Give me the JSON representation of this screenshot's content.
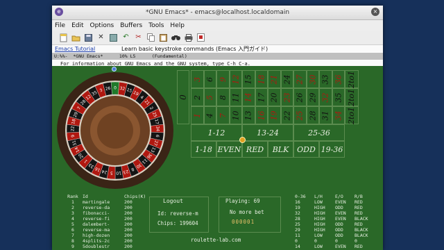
{
  "window": {
    "title": "*GNU Emacs* - emacs@localhost.localdomain"
  },
  "menu": [
    "File",
    "Edit",
    "Options",
    "Buffers",
    "Tools",
    "Help"
  ],
  "toolbar_icons": [
    "new-file-icon",
    "open-folder-icon",
    "save-icon",
    "close-x-icon",
    "save-as-icon",
    "undo-icon",
    "cut-icon",
    "copy-icon",
    "paste-icon",
    "search-binoculars-icon",
    "print-icon",
    "help-icon"
  ],
  "tabline": {
    "link": "Emacs Tutorial",
    "text": "Learn basic keystroke commands (Emacs 入門ガイド)"
  },
  "modeline": {
    "text": "U:%%-  *GNU Emacs*      10% L5      (Fundamental)"
  },
  "echo": {
    "text": "For information about GNU Emacs and the GNU system, type C-h C-a."
  },
  "table": {
    "zero": "0",
    "numbers": [
      [
        "3",
        "6",
        "9",
        "12",
        "15",
        "18",
        "21",
        "24",
        "27",
        "30",
        "33",
        "36"
      ],
      [
        "2",
        "5",
        "8",
        "11",
        "14",
        "17",
        "20",
        "23",
        "26",
        "29",
        "32",
        "35"
      ],
      [
        "1",
        "4",
        "7",
        "10",
        "13",
        "16",
        "19",
        "22",
        "25",
        "28",
        "31",
        "34"
      ]
    ],
    "red_numbers": [
      "1",
      "3",
      "5",
      "7",
      "9",
      "12",
      "14",
      "16",
      "18",
      "19",
      "21",
      "23",
      "25",
      "27",
      "30",
      "32",
      "34",
      "36"
    ],
    "columns": [
      "2to1",
      "2to1",
      "2to1"
    ],
    "dozens": [
      "1-12",
      "13-24",
      "25-36"
    ],
    "outside": [
      "1-18",
      "EVEN",
      "RED",
      "BLK",
      "ODD",
      "19-36"
    ]
  },
  "wheel": {
    "pockets": [
      "0",
      "32",
      "15",
      "19",
      "4",
      "21",
      "2",
      "25",
      "17",
      "34",
      "6",
      "27",
      "13",
      "36",
      "11",
      "30",
      "8",
      "23",
      "10",
      "5",
      "24",
      "16",
      "33",
      "1",
      "20",
      "14",
      "31",
      "9",
      "22",
      "18",
      "29",
      "7",
      "28",
      "12",
      "35",
      "3",
      "26"
    ],
    "colors": {
      "red": "#b01810",
      "black": "#141414",
      "green": "#1f7a2a",
      "wood": "#6b4023",
      "rim": "#3a2416"
    }
  },
  "ranking": {
    "headers": [
      "Rank",
      "Id",
      "Chips(K)"
    ],
    "rows": [
      [
        "1",
        "martingale",
        "200"
      ],
      [
        "2",
        "reverse-da",
        "200"
      ],
      [
        "3",
        "fibonacci-",
        "200"
      ],
      [
        "4",
        "reverse-fi",
        "200"
      ],
      [
        "5",
        "dalembert-",
        "200"
      ],
      [
        "6",
        "reverse-ma",
        "200"
      ],
      [
        "7",
        "high-dozen",
        "200"
      ],
      [
        "8",
        "4splits-2c",
        "200"
      ],
      [
        "9",
        "5doublestr",
        "200"
      ],
      [
        "10",
        "labouchere",
        "200"
      ]
    ]
  },
  "player": {
    "logout": "Logout",
    "id": "Id: reverse-m",
    "chips": "Chips: 199604"
  },
  "status": {
    "playing": "Playing: 69",
    "betting": "No more bet",
    "counter": "000001",
    "site": "roulette-lab.com"
  },
  "history": {
    "headers": [
      "0-36",
      "L/H",
      "E/O",
      "R/B"
    ],
    "rows": [
      [
        "16",
        "LOW",
        "EVEN",
        "RED"
      ],
      [
        "19",
        "HIGH",
        "ODD",
        "RED"
      ],
      [
        "32",
        "HIGH",
        "EVEN",
        "RED"
      ],
      [
        "28",
        "HIGH",
        "EVEN",
        "BLACK"
      ],
      [
        "25",
        "HIGH",
        "ODD",
        "RED"
      ],
      [
        "29",
        "HIGH",
        "ODD",
        "BLACK"
      ],
      [
        "11",
        "LOW",
        "ODD",
        "BLACK"
      ],
      [
        "0",
        "0",
        "0",
        "0"
      ],
      [
        "14",
        "LOW",
        "EVEN",
        "RED"
      ]
    ]
  }
}
